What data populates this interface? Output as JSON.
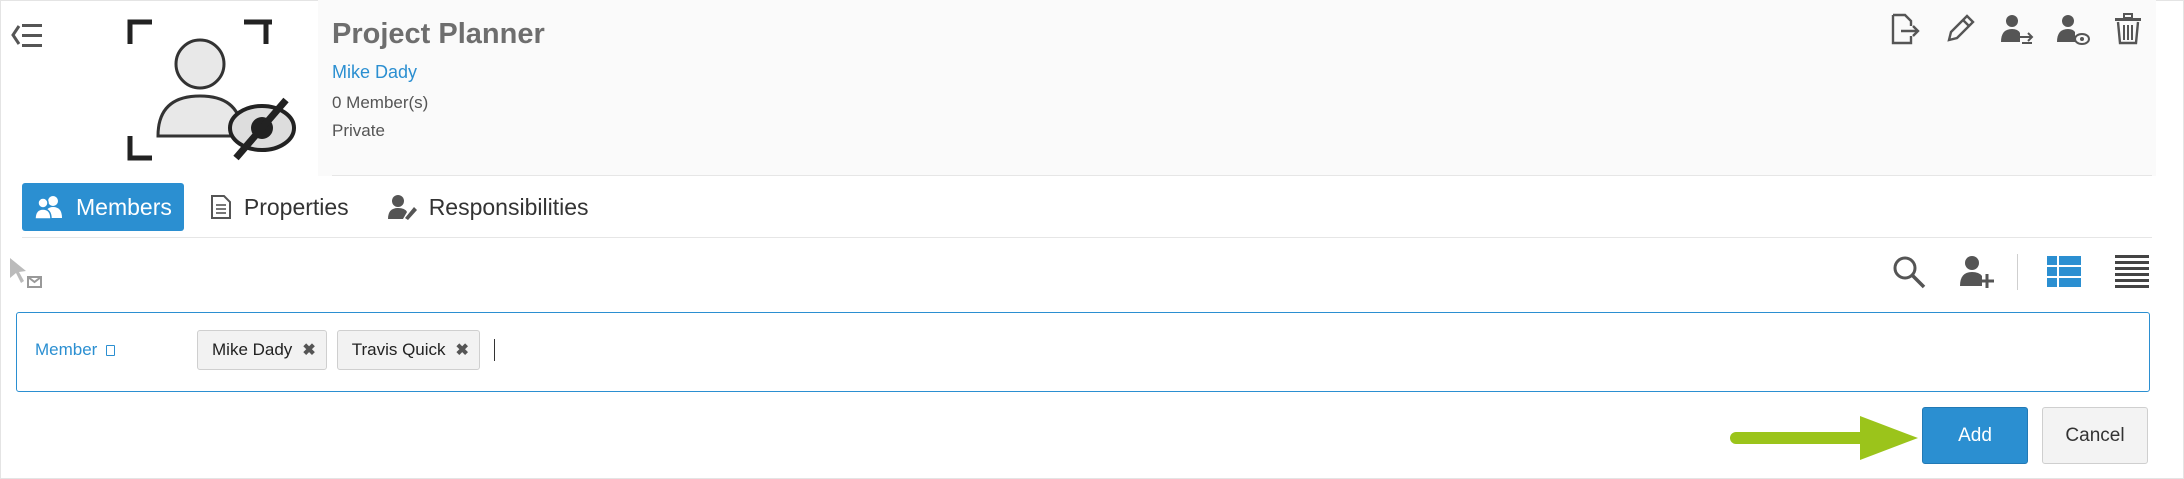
{
  "header": {
    "title": "Project Planner",
    "owner": "Mike Dady",
    "members_count": "0 Member(s)",
    "privacy": "Private"
  },
  "top_actions": [
    {
      "icon": "export-icon"
    },
    {
      "icon": "edit-pencil-icon"
    },
    {
      "icon": "transfer-ownership-icon"
    },
    {
      "icon": "visibility-icon"
    },
    {
      "icon": "trash-icon"
    }
  ],
  "tabs": [
    {
      "label": "Members",
      "icon": "members-icon",
      "active": true
    },
    {
      "label": "Properties",
      "icon": "document-icon",
      "active": false
    },
    {
      "label": "Responsibilities",
      "icon": "responsibilities-icon",
      "active": false
    }
  ],
  "member_form": {
    "label": "Member",
    "selected": [
      "Mike Dady",
      "Travis Quick"
    ],
    "remove_glyph": "✖"
  },
  "buttons": {
    "add": "Add",
    "cancel": "Cancel"
  },
  "colors": {
    "accent": "#2b8fd1",
    "arrow": "#9bc41b",
    "title": "#6e6e6e"
  }
}
